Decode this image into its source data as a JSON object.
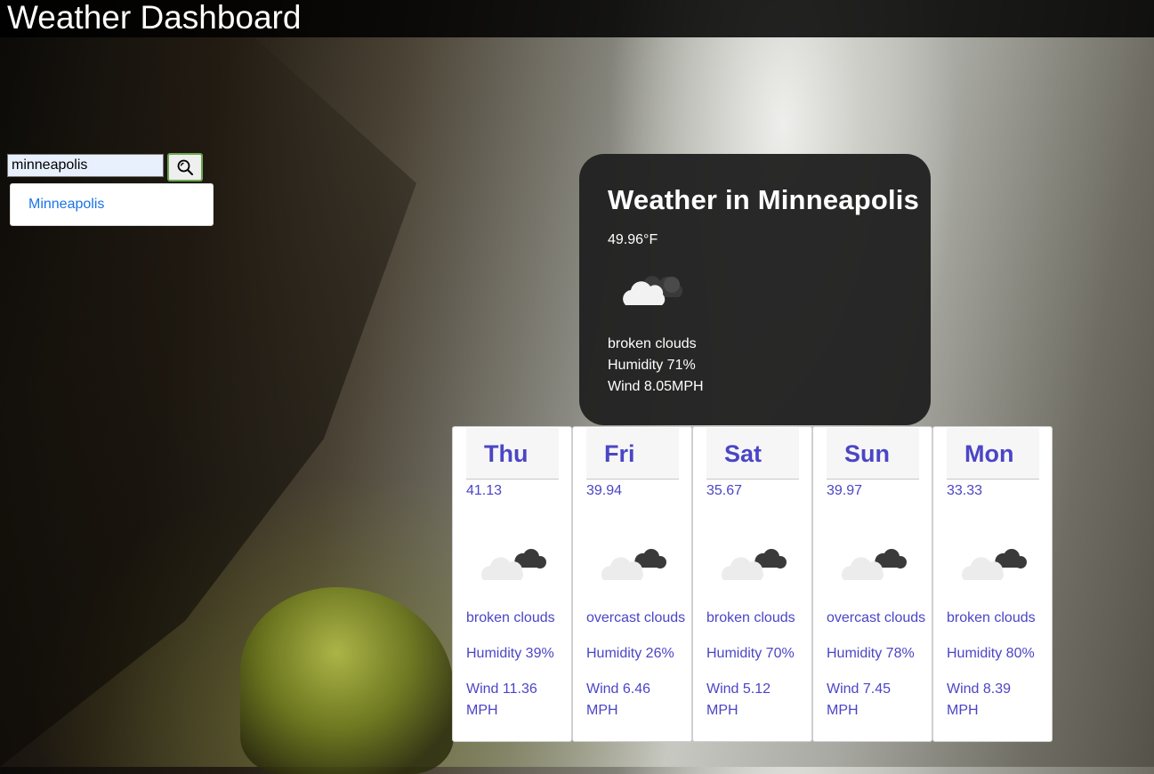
{
  "header": {
    "title": "Weather Dashboard"
  },
  "search": {
    "value": "minneapolis",
    "suggestion": "Minneapolis"
  },
  "current": {
    "title": "Weather in Minneapolis",
    "temp": "49.96°F",
    "icon": "broken-clouds-icon",
    "description": "broken clouds",
    "humidity": "Humidity 71%",
    "wind": "Wind 8.05MPH"
  },
  "forecast": [
    {
      "day": "Thu",
      "temp": "41.13",
      "description": "broken clouds",
      "humidity": "Humidity 39%",
      "wind": "Wind 11.36 MPH"
    },
    {
      "day": "Fri",
      "temp": "39.94",
      "description": "overcast clouds",
      "humidity": "Humidity 26%",
      "wind": "Wind 6.46 MPH"
    },
    {
      "day": "Sat",
      "temp": "35.67",
      "description": "broken clouds",
      "humidity": "Humidity 70%",
      "wind": "Wind 5.12 MPH"
    },
    {
      "day": "Sun",
      "temp": "39.97",
      "description": "overcast clouds",
      "humidity": "Humidity 78%",
      "wind": "Wind 7.45 MPH"
    },
    {
      "day": "Mon",
      "temp": "33.33",
      "description": "broken clouds",
      "humidity": "Humidity 80%",
      "wind": "Wind 8.39 MPH"
    }
  ],
  "colors": {
    "forecast_text": "#4b45c6",
    "link": "#1a73e8",
    "card_dark": "#222222"
  }
}
